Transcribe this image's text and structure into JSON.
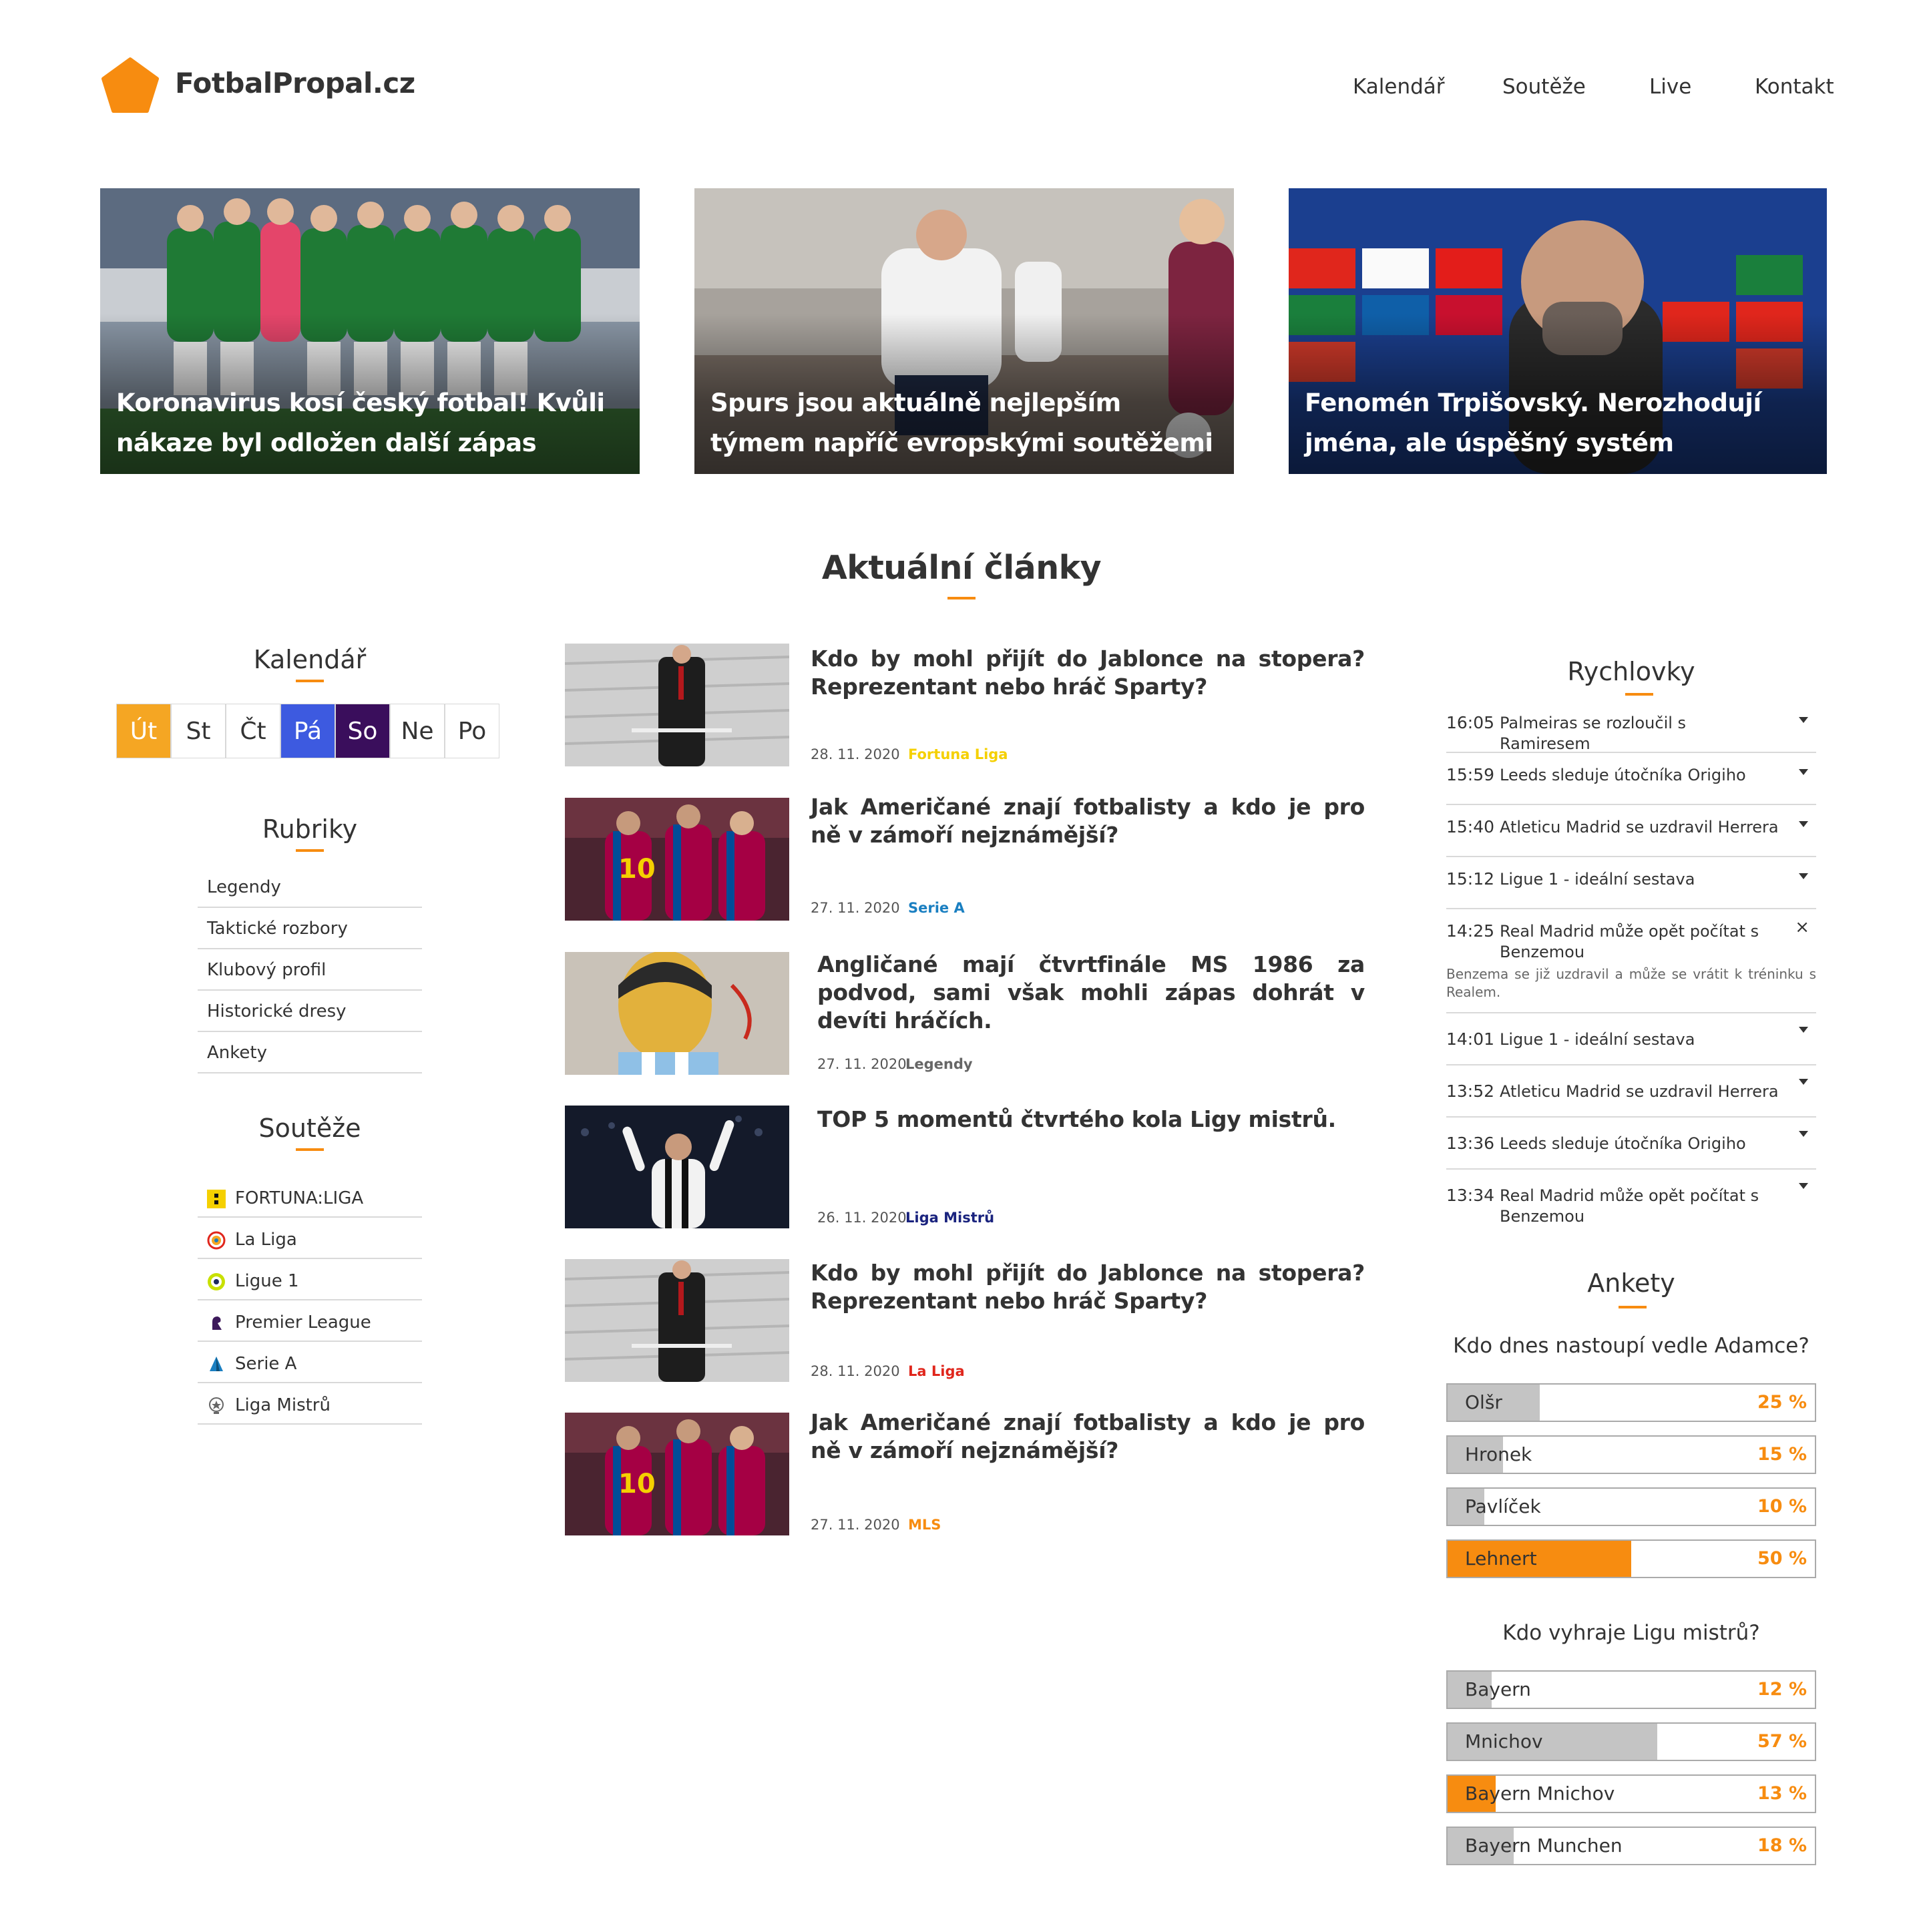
{
  "brand": {
    "name": "FotbalPropal.cz",
    "accent": "#f78c10"
  },
  "nav": [
    "Kalendář",
    "Soutěže",
    "Live",
    "Kontakt"
  ],
  "hero": [
    {
      "title": "Koronavirus kosí český fotbal! Kvůli nákaze byl odložen další zápas"
    },
    {
      "title": "Spurs jsou aktuálně nejlepším týmem napříč evropskými soutěžemi"
    },
    {
      "title": "Fenomén Trpišovský. Nerozhodují jména, ale úspěšný systém"
    }
  ],
  "section_title": "Aktuální články",
  "calendar": {
    "title": "Kalendář",
    "days": [
      {
        "label": "Út",
        "bg": "#f5a623",
        "color": "#ffffff"
      },
      {
        "label": "St",
        "bg": "#ffffff",
        "color": "#333333"
      },
      {
        "label": "Čt",
        "bg": "#ffffff",
        "color": "#333333"
      },
      {
        "label": "Pá",
        "bg": "#3d5ae0",
        "color": "#ffffff"
      },
      {
        "label": "So",
        "bg": "#3a0e5c",
        "color": "#ffffff"
      },
      {
        "label": "Ne",
        "bg": "#ffffff",
        "color": "#333333"
      },
      {
        "label": "Po",
        "bg": "#ffffff",
        "color": "#333333"
      }
    ]
  },
  "rubriky": {
    "title": "Rubriky",
    "items": [
      "Legendy",
      "Taktické rozbory",
      "Klubový profil",
      "Historické dresy",
      "Ankety"
    ]
  },
  "souteze": {
    "title": "Soutěže",
    "items": [
      {
        "label": "FORTUNA:LIGA",
        "icon": "fortuna-liga-icon"
      },
      {
        "label": "La Liga",
        "icon": "la-liga-icon"
      },
      {
        "label": "Ligue 1",
        "icon": "ligue-1-icon"
      },
      {
        "label": "Premier League",
        "icon": "premier-league-icon"
      },
      {
        "label": "Serie A",
        "icon": "serie-a-icon"
      },
      {
        "label": "Liga Mistrů",
        "icon": "liga-mistru-icon"
      }
    ]
  },
  "articles": [
    {
      "title": "Kdo by mohl přijít do Jablonce na stopera? Reprezentant nebo hráč Sparty?",
      "date": "28. 11. 2020",
      "category": "Fortuna Liga",
      "category_color": "#f5d000"
    },
    {
      "title": "Jak Američané znají fotbalisty a kdo je pro ně v zámoří nejznámější?",
      "date": "27. 11. 2020",
      "category": "Serie A",
      "category_color": "#1a7fc1"
    },
    {
      "title": "Angličané mají čtvrtfinále MS 1986 za podvod, sami však mohli zápas dohrát v devíti hráčích.",
      "date": "27. 11. 2020",
      "category": "Legendy",
      "category_color": "#666666"
    },
    {
      "title": "TOP 5 momentů čtvrtého kola Ligy mistrů.",
      "date": "26. 11. 2020",
      "category": "Liga Mistrů",
      "category_color": "#1a237e"
    },
    {
      "title": "Kdo by mohl přijít do Jablonce na stopera? Reprezentant nebo hráč Sparty?",
      "date": "28. 11. 2020",
      "category": "La Liga",
      "category_color": "#e0261c"
    },
    {
      "title": "Jak Američané znají fotbalisty a kdo je pro ně v zámoří nejznámější?",
      "date": "27. 11. 2020",
      "category": "MLS",
      "category_color": "#f78c10"
    }
  ],
  "rychlovky": {
    "title": "Rychlovky",
    "items": [
      {
        "time": "16:05",
        "text": "Palmeiras se rozloučil s Ramiresem"
      },
      {
        "time": "15:59",
        "text": "Leeds sleduje útočníka Origiho"
      },
      {
        "time": "15:40",
        "text": "Atleticu Madrid se uzdravil Herrera"
      },
      {
        "time": "15:12",
        "text": "Ligue 1 - ideální sestava"
      },
      {
        "time": "14:25",
        "text": "Real Madrid může opět počítat s Benzemou",
        "detail": "Benzema se již uzdravil a může se vrátit k tréninku s Realem.",
        "expanded": true
      },
      {
        "time": "14:01",
        "text": "Ligue 1 - ideální sestava"
      },
      {
        "time": "13:52",
        "text": "Atleticu Madrid se uzdravil Herrera"
      },
      {
        "time": "13:36",
        "text": "Leeds sleduje útočníka Origiho"
      },
      {
        "time": "13:34",
        "text": "Real Madrid může opět počítat s Benzemou"
      }
    ]
  },
  "ankety": {
    "title": "Ankety",
    "polls": [
      {
        "question": "Kdo dnes nastoupí vedle Adamce?",
        "options": [
          {
            "label": "Olšr",
            "pct": "25 %",
            "value": 25,
            "selected": false
          },
          {
            "label": "Hronek",
            "pct": "15 %",
            "value": 15,
            "selected": false
          },
          {
            "label": "Pavlíček",
            "pct": "10 %",
            "value": 10,
            "selected": false
          },
          {
            "label": "Lehnert",
            "pct": "50 %",
            "value": 50,
            "selected": true
          }
        ]
      },
      {
        "question": "Kdo vyhraje Ligu mistrů?",
        "options": [
          {
            "label": "Bayern",
            "pct": "12 %",
            "value": 12,
            "selected": false
          },
          {
            "label": "Mnichov",
            "pct": "57 %",
            "value": 57,
            "selected": false
          },
          {
            "label": "Bayern Mnichov",
            "pct": "13 %",
            "value": 13,
            "selected": true
          },
          {
            "label": "Bayern Munchen",
            "pct": "18 %",
            "value": 18,
            "selected": false
          }
        ]
      }
    ]
  }
}
